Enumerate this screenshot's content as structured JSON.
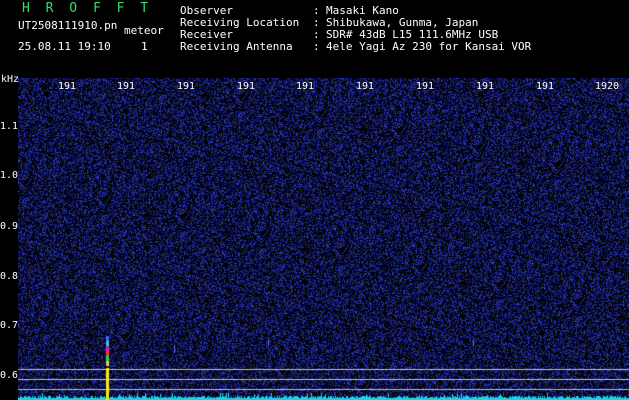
{
  "header": {
    "brand": "H R O F F T",
    "file_name": "UT2508111910.pn",
    "meteor_label": "meteor",
    "date_time": "25.08.11 19:10",
    "count": "1"
  },
  "metadata": [
    {
      "label": "Observer",
      "value": "Masaki Kano"
    },
    {
      "label": "Receiving Location",
      "value": "Shibukawa, Gunma, Japan"
    },
    {
      "label": "Receiver",
      "value": "SDR# 43dB L15 111.6MHz USB"
    },
    {
      "label": "Receiving Antenna",
      "value": "4ele Yagi Az 230 for Kansai VOR"
    }
  ],
  "axis": {
    "unit": "kHz",
    "y_ticks": [
      "1.1",
      "1.0",
      "0.9",
      "0.8",
      "0.7",
      "0.6"
    ],
    "x_ticks": [
      "191",
      "191",
      "191",
      "191",
      "191",
      "191",
      "191",
      "191",
      "191",
      "1920"
    ]
  },
  "colors": {
    "background": "#000000",
    "noise_blue": "#1f2fa8",
    "baseline_cyan": "#19d3e6",
    "meteor_yellow": "#f5ea12",
    "guide_line": "#c9d7ff",
    "brand_green": "#2fe06a"
  }
}
